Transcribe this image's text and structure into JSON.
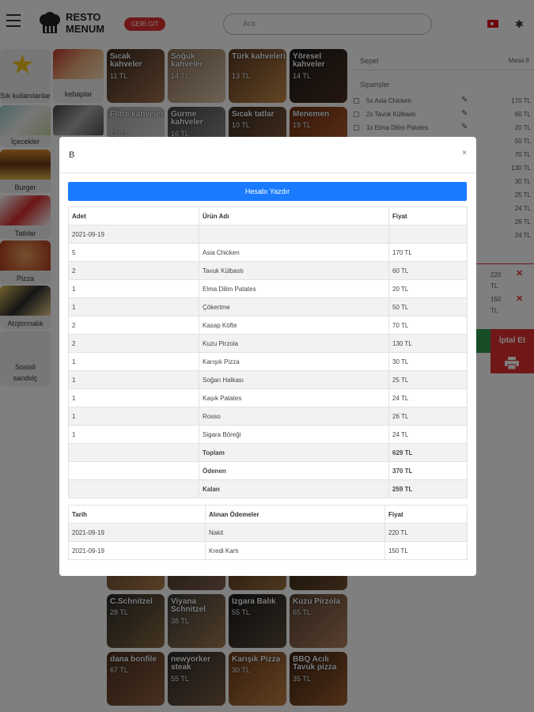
{
  "header": {
    "logo_text_1": "RESTO",
    "logo_text_2": "MENUM",
    "back_label": "GERİ GİT",
    "search_placeholder": "Ara"
  },
  "categories": [
    {
      "label": "Sık kullanılanlar"
    },
    {
      "label": "kebaplar"
    },
    {
      "label": "İçecekler"
    },
    {
      "label": "Burger"
    },
    {
      "label": "Tatlılar"
    },
    {
      "label": "Pizza"
    },
    {
      "label": "Atıştırmalık"
    },
    {
      "label": "Sosisli sandviç"
    }
  ],
  "products_top": [
    {
      "name": "Sıcak kahveler",
      "price": "11 TL"
    },
    {
      "name": "Soğuk kahveler",
      "price": "14 TL"
    },
    {
      "name": "Türk kahveleri",
      "price": "13 TL"
    },
    {
      "name": "Yöresel kahveler",
      "price": "14 TL"
    },
    {
      "name": "Filtre kahveler",
      "price": "12 TL"
    },
    {
      "name": "Gurme kahveler",
      "price": "16 TL"
    },
    {
      "name": "Sıcak tatlar",
      "price": "10 TL"
    },
    {
      "name": "Menemen",
      "price": "19 TL"
    }
  ],
  "products_bottom": [
    {
      "name": "C.Schnitzel",
      "price": "28 TL"
    },
    {
      "name": "Viyana Schnitzel",
      "price": "38 TL"
    },
    {
      "name": "Izgara Balık",
      "price": "55 TL"
    },
    {
      "name": "Kuzu Pirzola",
      "price": "65 TL"
    },
    {
      "name": "dana bonfile",
      "price": "67 TL"
    },
    {
      "name": "newyorker steak",
      "price": "55 TL"
    },
    {
      "name": "Karışık Pizza",
      "price": "30 TL"
    },
    {
      "name": "BBQ Acılı Tavuk pizza",
      "price": "35 TL"
    }
  ],
  "sidebar": {
    "sepet_label": "Sepet",
    "table_label": "Masa 8",
    "orders_label": "Siparişler",
    "orders": [
      {
        "name": "5x Asia Chicken",
        "price": "170 TL"
      },
      {
        "name": "2x Tavuk Külbastı",
        "price": "60 TL"
      },
      {
        "name": "1x Elma Dilim Patates",
        "price": "20 TL"
      }
    ],
    "prices_hidden": [
      "50 TL",
      "70 TL",
      "130 TL",
      "30 TL",
      "25 TL",
      "24 TL",
      "26 TL",
      "24 TL"
    ],
    "payments": [
      {
        "amount": "220",
        "unit": "TL"
      },
      {
        "amount": "150",
        "unit": "TL"
      }
    ],
    "cancel_label": "İptal Et"
  },
  "modal": {
    "title": "B",
    "close": "×",
    "print_label": "Hesabı Yazdır",
    "columns": [
      "Adet",
      "Ürün Adı",
      "Fiyat"
    ],
    "date": "2021-09-19",
    "items": [
      {
        "qty": "5",
        "name": "Asia Chicken",
        "price": "170 TL"
      },
      {
        "qty": "2",
        "name": "Tavuk Külbastı",
        "price": "60 TL"
      },
      {
        "qty": "1",
        "name": "Elma Dilim Patates",
        "price": "20 TL"
      },
      {
        "qty": "1",
        "name": "Çökertme",
        "price": "50 TL"
      },
      {
        "qty": "2",
        "name": "Kasap Köfte",
        "price": "70 TL"
      },
      {
        "qty": "2",
        "name": "Kuzu Pirzola",
        "price": "130 TL"
      },
      {
        "qty": "1",
        "name": "Karışık Pizza",
        "price": "30 TL"
      },
      {
        "qty": "1",
        "name": "Soğan Halkası",
        "price": "25 TL"
      },
      {
        "qty": "1",
        "name": "Kaşık Patates",
        "price": "24 TL"
      },
      {
        "qty": "1",
        "name": "Rosso",
        "price": "26 TL"
      },
      {
        "qty": "1",
        "name": "Sigara Böreği",
        "price": "24 TL"
      }
    ],
    "totals": [
      {
        "label": "Toplam",
        "value": "629 TL"
      },
      {
        "label": "Ödenen",
        "value": "370 TL"
      },
      {
        "label": "Kalan",
        "value": "259 TL"
      }
    ],
    "pay_columns": [
      "Tarih",
      "Alınan Ödemeler",
      "Fiyat"
    ],
    "pay_rows": [
      {
        "date": "2021-09-19",
        "type": "Nakit",
        "price": "220 TL"
      },
      {
        "date": "2021-09-19",
        "type": "Kredi Kartı",
        "price": "150 TL"
      }
    ]
  }
}
